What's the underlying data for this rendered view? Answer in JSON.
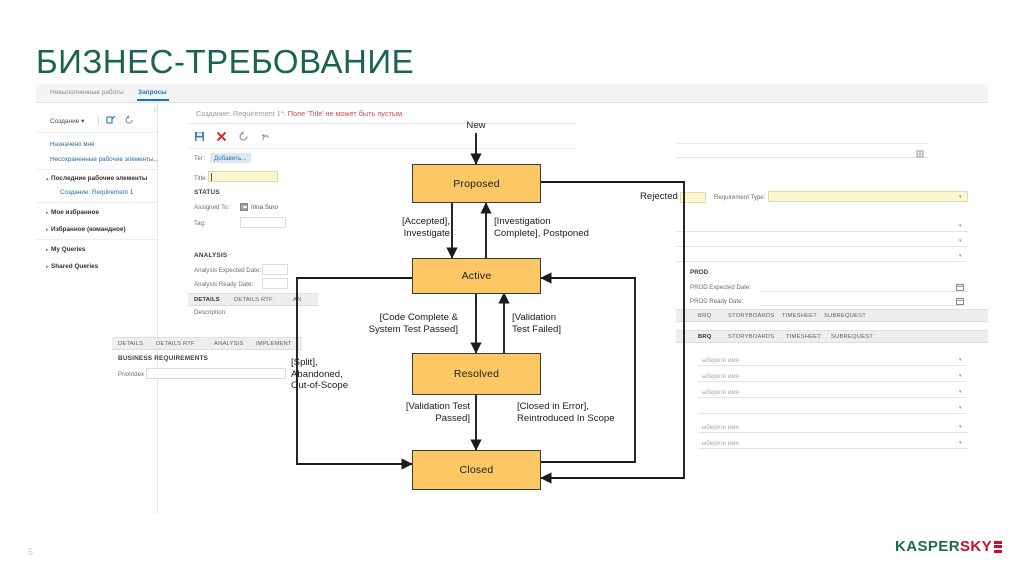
{
  "slide": {
    "title": "БИЗНЕС-ТРЕБОВАНИЕ",
    "page_number": "5",
    "brand": {
      "name_dark": "KASPER",
      "name_red": "SKY",
      "mark": "brand-bars-icon"
    },
    "accent_color": "#1a6350",
    "node_fill": "#fbc863",
    "node_stroke": "#3a3a3a"
  },
  "app": {
    "tabs": [
      {
        "label": "Невыполненные работы",
        "active": false
      },
      {
        "label": "Запросы",
        "active": true
      }
    ],
    "sidebar": {
      "create_button": "Создание ▾",
      "icons": [
        "new-query-icon",
        "refresh-icon"
      ],
      "links": [
        "Назначено мне",
        "Несохраненные рабочие элементы..."
      ],
      "groups": [
        {
          "label": "Последние рабочие элементы",
          "expanded": true,
          "child": "Создание: Requirement 1"
        },
        {
          "label": "Мое избранное",
          "expanded": false
        },
        {
          "label": "Избранное (командное)",
          "expanded": false
        },
        {
          "label": "My Queries",
          "expanded": false
        },
        {
          "label": "Shared Queries",
          "expanded": false
        }
      ]
    },
    "center": {
      "error_prefix": "Создание: Requirement 1*: ",
      "error_text": "Поле 'Title' не может быть пустым.",
      "toolbar_icons": [
        "save-icon",
        "delete-icon",
        "refresh-icon",
        "undo-icon"
      ],
      "tag_label": "Тег:",
      "tag_chip": "Добавить...",
      "title_label": "Title:",
      "title_value": "",
      "status_section": "STATUS",
      "assigned_to_label": "Assigned To:",
      "assigned_to_value": "Irina Suro",
      "tag2_label": "Tag:",
      "analysis_section": "ANALYSIS",
      "analysis_expected_label": "Analysis Expected Date:",
      "analysis_ready_label": "Analysis Ready Date:",
      "tabstrip_inner": [
        "DETAILS",
        "DETAILS RTF",
        "AN"
      ],
      "description_label": "Description:",
      "tabstrip_outer": [
        "DETAILS",
        "DETAILS RTF",
        "ANALYSIS",
        "IMPLEMENT"
      ],
      "business_section": "BUSINESS REQUIREMENTS",
      "prio_label": "PrioIndex"
    },
    "right": {
      "expand_icon": "expand-field-icon",
      "requirement_type_label": "Requirement Type:",
      "prod_section": "PROD",
      "prod_expected_label": "PROD Expected Date:",
      "prod_ready_label": "PROD Ready Date:",
      "calendar_icon": "calendar-icon",
      "tabstrip_back": [
        "BRQ",
        "STORYBOARDS",
        "TIMESHEET",
        "SUBREQUEST"
      ],
      "tabstrip_front": [
        "BRQ",
        "STORYBOARDS",
        "TIMESHEET",
        "SUBREQUEST"
      ],
      "dropdown_placeholder": "ыберите имя",
      "dropdown_rows": 6
    }
  },
  "diagram": {
    "type": "state-machine",
    "nodes": [
      {
        "id": "proposed",
        "label": "Proposed"
      },
      {
        "id": "active",
        "label": "Active"
      },
      {
        "id": "resolved",
        "label": "Resolved"
      },
      {
        "id": "closed",
        "label": "Closed"
      }
    ],
    "transitions": [
      {
        "from": "start",
        "to": "proposed",
        "label": "New"
      },
      {
        "from": "proposed",
        "to": "active",
        "label": "[Accepted],\nInvestigate"
      },
      {
        "from": "active",
        "to": "proposed",
        "label": "[Investigation\nComplete], Postponed"
      },
      {
        "from": "proposed",
        "to": "closed",
        "label": "Rejected"
      },
      {
        "from": "active",
        "to": "resolved",
        "label": "[Code Complete &\nSystem Test Passed]"
      },
      {
        "from": "resolved",
        "to": "active",
        "label": "[Validation\nTest Failed]"
      },
      {
        "from": "active",
        "to": "closed",
        "label": "[Split],\nAbandoned,\nOut-of-Scope"
      },
      {
        "from": "resolved",
        "to": "closed",
        "label": "[Validation Test\nPassed]"
      },
      {
        "from": "closed",
        "to": "active",
        "label": "[Closed in Error],\nReintroduced In Scope"
      }
    ]
  }
}
